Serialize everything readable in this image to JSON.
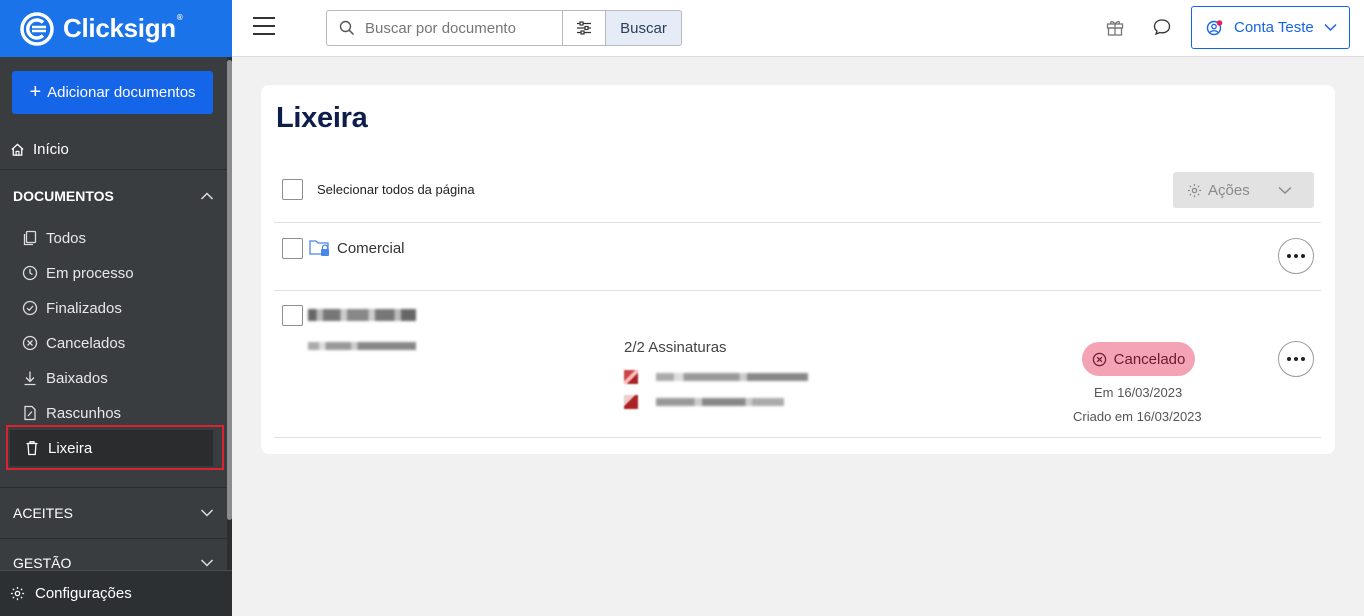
{
  "app": {
    "logo_text": "Clicksign",
    "logo_reg": "®"
  },
  "colors": {
    "brand": "#1a73e8",
    "sidebar_bg": "#3a3d40",
    "highlight": "#d9232e",
    "cancel_badge": "#f3a3b4"
  },
  "sidebar": {
    "add_button": "Adicionar documentos",
    "inicio": "Início",
    "documentos_header": "DOCUMENTOS",
    "items": [
      {
        "label": "Todos",
        "icon": "copy-icon"
      },
      {
        "label": "Em processo",
        "icon": "clock-icon"
      },
      {
        "label": "Finalizados",
        "icon": "check-circle-icon"
      },
      {
        "label": "Cancelados",
        "icon": "x-circle-icon"
      },
      {
        "label": "Baixados",
        "icon": "download-icon"
      },
      {
        "label": "Rascunhos",
        "icon": "draft-icon"
      },
      {
        "label": "Lixeira",
        "icon": "trash-icon",
        "active": true
      }
    ],
    "aceites_header": "ACEITES",
    "gestao_header": "GESTÃO",
    "config": "Configurações"
  },
  "header": {
    "search_placeholder": "Buscar por documento",
    "search_button": "Buscar",
    "account_label": "Conta Teste"
  },
  "main": {
    "title": "Lixeira",
    "select_all": "Selecionar todos da página",
    "actions": "Ações",
    "folder": {
      "name": "Comercial"
    },
    "document": {
      "signatures": "2/2 Assinaturas",
      "status": "Cancelado",
      "date": "Em 16/03/2023",
      "created": "Criado em 16/03/2023"
    }
  }
}
